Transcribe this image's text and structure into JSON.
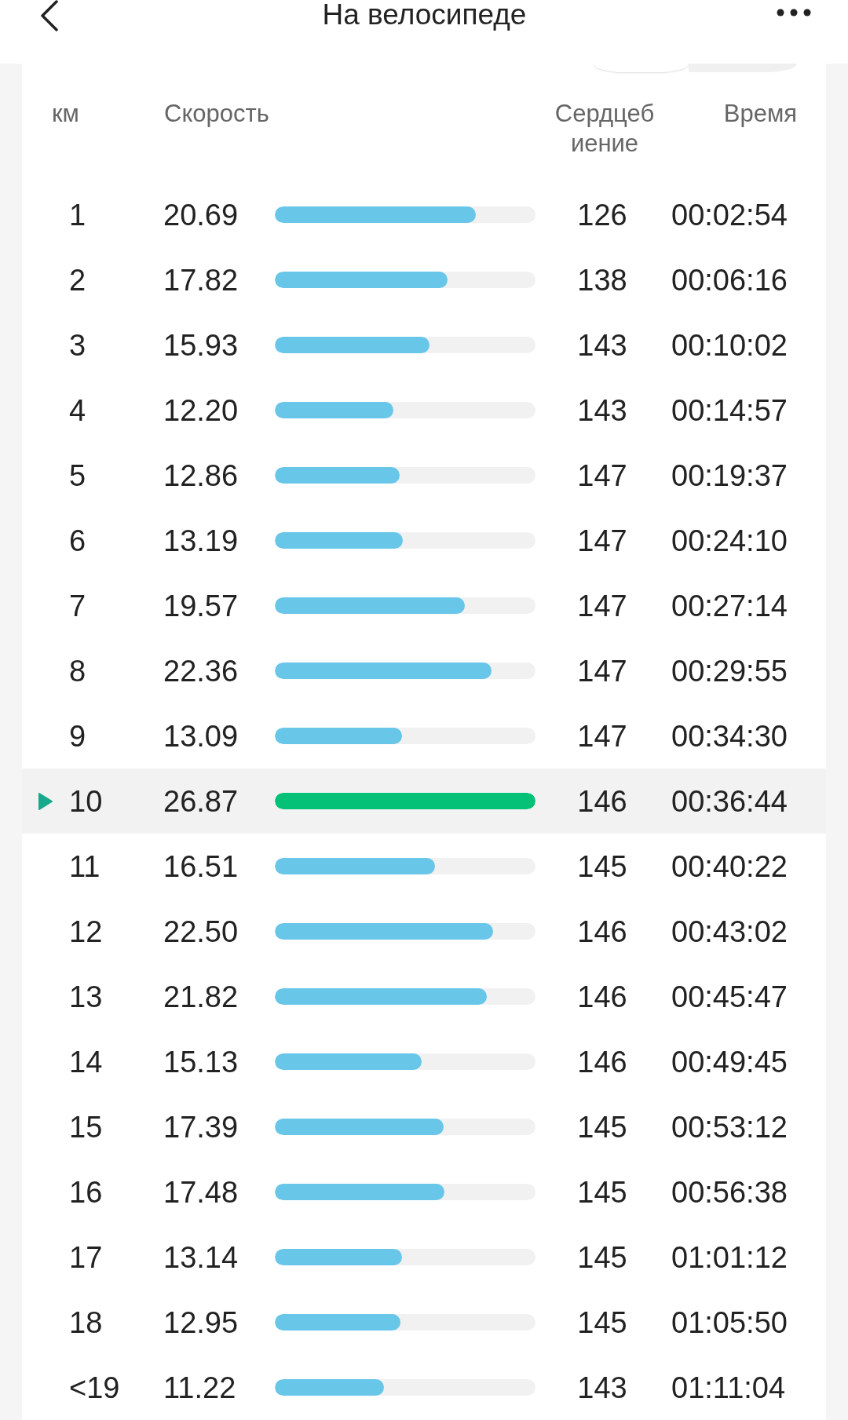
{
  "header": {
    "title": "На велосипеде"
  },
  "view_toggle": {
    "segments": [
      {
        "selected": true
      },
      {
        "selected": false
      }
    ]
  },
  "table": {
    "columns": [
      "км",
      "Скорость",
      "Сердцебиение",
      "Время"
    ],
    "rows": [
      {
        "km": "1",
        "speed": "20.69",
        "level": 0.77,
        "heart_rate": "126",
        "time": "00:02:54",
        "fastest": false
      },
      {
        "km": "2",
        "speed": "17.82",
        "level": 0.663,
        "heart_rate": "138",
        "time": "00:06:16",
        "fastest": false
      },
      {
        "km": "3",
        "speed": "15.93",
        "level": 0.593,
        "heart_rate": "143",
        "time": "00:10:02",
        "fastest": false
      },
      {
        "km": "4",
        "speed": "12.20",
        "level": 0.454,
        "heart_rate": "143",
        "time": "00:14:57",
        "fastest": false
      },
      {
        "km": "5",
        "speed": "12.86",
        "level": 0.479,
        "heart_rate": "147",
        "time": "00:19:37",
        "fastest": false
      },
      {
        "km": "6",
        "speed": "13.19",
        "level": 0.491,
        "heart_rate": "147",
        "time": "00:24:10",
        "fastest": false
      },
      {
        "km": "7",
        "speed": "19.57",
        "level": 0.728,
        "heart_rate": "147",
        "time": "00:27:14",
        "fastest": false
      },
      {
        "km": "8",
        "speed": "22.36",
        "level": 0.832,
        "heart_rate": "147",
        "time": "00:29:55",
        "fastest": false
      },
      {
        "km": "9",
        "speed": "13.09",
        "level": 0.487,
        "heart_rate": "147",
        "time": "00:34:30",
        "fastest": false
      },
      {
        "km": "10",
        "speed": "26.87",
        "level": 1.0,
        "heart_rate": "146",
        "time": "00:36:44",
        "fastest": true
      },
      {
        "km": "11",
        "speed": "16.51",
        "level": 0.614,
        "heart_rate": "145",
        "time": "00:40:22",
        "fastest": false
      },
      {
        "km": "12",
        "speed": "22.50",
        "level": 0.837,
        "heart_rate": "146",
        "time": "00:43:02",
        "fastest": false
      },
      {
        "km": "13",
        "speed": "21.82",
        "level": 0.812,
        "heart_rate": "146",
        "time": "00:45:47",
        "fastest": false
      },
      {
        "km": "14",
        "speed": "15.13",
        "level": 0.563,
        "heart_rate": "146",
        "time": "00:49:45",
        "fastest": false
      },
      {
        "km": "15",
        "speed": "17.39",
        "level": 0.647,
        "heart_rate": "145",
        "time": "00:53:12",
        "fastest": false
      },
      {
        "km": "16",
        "speed": "17.48",
        "level": 0.651,
        "heart_rate": "145",
        "time": "00:56:38",
        "fastest": false
      },
      {
        "km": "17",
        "speed": "13.14",
        "level": 0.489,
        "heart_rate": "145",
        "time": "01:01:12",
        "fastest": false
      },
      {
        "km": "18",
        "speed": "12.95",
        "level": 0.482,
        "heart_rate": "145",
        "time": "01:05:50",
        "fastest": false
      },
      {
        "km": "<19",
        "speed": "11.22",
        "level": 0.418,
        "heart_rate": "143",
        "time": "01:11:04",
        "fastest": false
      }
    ]
  }
}
